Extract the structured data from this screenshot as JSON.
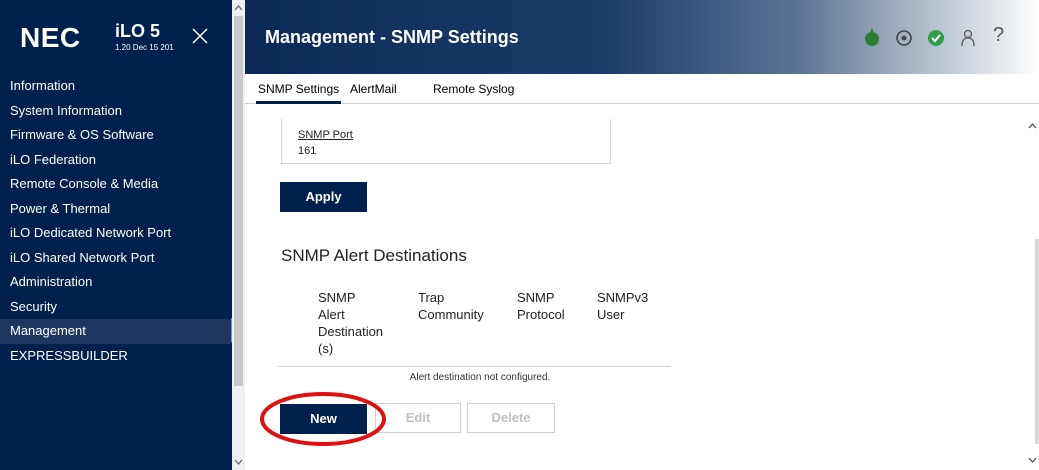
{
  "brand": {
    "logo": "NEC",
    "product": "iLO 5",
    "version": "1.20 Dec 15 201"
  },
  "sidebar": {
    "items": [
      {
        "label": "Information",
        "active": false
      },
      {
        "label": "System Information",
        "active": false
      },
      {
        "label": "Firmware & OS Software",
        "active": false
      },
      {
        "label": "iLO Federation",
        "active": false
      },
      {
        "label": "Remote Console & Media",
        "active": false
      },
      {
        "label": "Power & Thermal",
        "active": false
      },
      {
        "label": "iLO Dedicated Network Port",
        "active": false
      },
      {
        "label": "iLO Shared Network Port",
        "active": false
      },
      {
        "label": "Administration",
        "active": false
      },
      {
        "label": "Security",
        "active": false
      },
      {
        "label": "Management",
        "active": true
      },
      {
        "label": "EXPRESSBUILDER",
        "active": false
      }
    ]
  },
  "header": {
    "title": "Management - SNMP Settings",
    "icons": [
      "power-icon",
      "locate-icon",
      "health-check-icon",
      "user-icon",
      "help-icon"
    ],
    "help_glyph": "?",
    "status_colors": {
      "power": "#2e7d32",
      "health": "#2e9f48"
    }
  },
  "tabs": [
    {
      "label": "SNMP Settings",
      "active": true
    },
    {
      "label": "AlertMail",
      "active": false
    },
    {
      "label": "Remote Syslog",
      "active": false
    }
  ],
  "snmp_port": {
    "label": "SNMP Port",
    "value": "161"
  },
  "buttons": {
    "apply": "Apply",
    "new": "New",
    "edit": "Edit",
    "delete": "Delete"
  },
  "alert_destinations": {
    "title": "SNMP Alert Destinations",
    "columns": [
      "SNMP Alert Destination (s)",
      "Trap Community",
      "SNMP Protocol",
      "SNMPv3 User"
    ],
    "column_lines": [
      [
        "SNMP",
        "Alert",
        "Destination",
        "(s)"
      ],
      [
        "Trap",
        "Community"
      ],
      [
        "SNMP",
        "Protocol"
      ],
      [
        "SNMPv3",
        "User"
      ]
    ],
    "empty_message": "Alert destination not configured."
  },
  "colors": {
    "navy": "#00204e",
    "highlight": "#e01010"
  }
}
